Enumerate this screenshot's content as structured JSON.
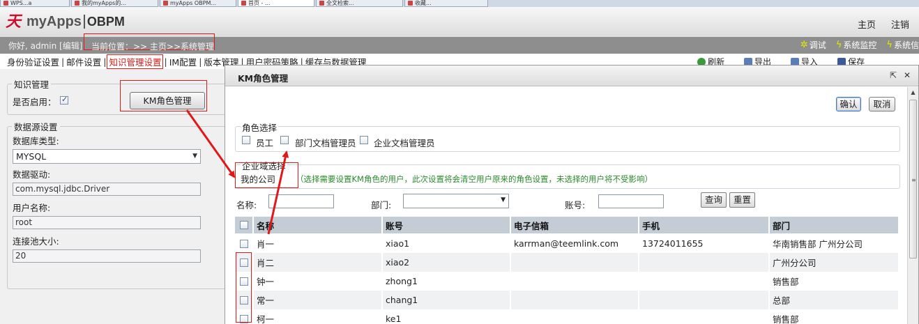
{
  "browser_tabs": [
    "WPS...a",
    "我的myApps的...",
    "myApps OBPM...",
    "首页 - ...",
    "全文检索...",
    "收藏..."
  ],
  "app": {
    "brand": "myApps",
    "product": "OBPM",
    "top_links": [
      "主页",
      "注销"
    ]
  },
  "infobar": {
    "greeting": "你好, admin [编辑]",
    "location": "当前位置：>> 主页>>系统管理",
    "tools": [
      {
        "icon": "debug-icon",
        "label": "调试"
      },
      {
        "icon": "lightning-icon",
        "label": "系统监控"
      },
      {
        "icon": "lightning-icon",
        "label": "系统信"
      }
    ]
  },
  "settings_tabs": [
    "身份验证设置",
    "邮件设置",
    "知识管理设置",
    "IM配置",
    "版本管理",
    "用户密码策略",
    "缓存与数据管理"
  ],
  "settings_tab_active": 2,
  "right_toolbar": [
    "刷新",
    "导出",
    "导入",
    "保存"
  ],
  "left": {
    "km_legend": "知识管理",
    "enable_label": "是否启用：",
    "km_role_button": "KM角色管理",
    "ds_legend": "数据源设置",
    "db_type_label": "数据库类型:",
    "db_type_value": "MYSQL",
    "driver_label": "数据驱动:",
    "driver_value": "com.mysql.jdbc.Driver",
    "user_label": "用户名称:",
    "user_value": "root",
    "pool_label": "连接池大小:",
    "pool_value": "20"
  },
  "modal": {
    "title": "KM角色管理",
    "ok": "确认",
    "cancel": "取消",
    "role_legend": "角色选择",
    "roles": [
      "员工",
      "部门文档管理员",
      "企业文档管理员"
    ],
    "corp_legend": "企业域选择",
    "corp_value": "我的公司",
    "hint": "（选择需要设置KM角色的用户，此次设置将会清空用户原来的角色设置，未选择的用户将不受影响）",
    "filter": {
      "name_label": "名称:",
      "dept_label": "部门:",
      "account_label": "账号:",
      "search": "查询",
      "reset": "重置"
    },
    "columns": [
      "名称",
      "账号",
      "电子信箱",
      "手机",
      "部门"
    ],
    "rows": [
      {
        "name": "肖一",
        "account": "xiao1",
        "email": "karrman@teemlink.com",
        "phone": "13724011655",
        "dept": "华南销售部  广州分公司"
      },
      {
        "name": "肖二",
        "account": "xiao2",
        "email": "",
        "phone": "",
        "dept": "广州分公司"
      },
      {
        "name": "钟一",
        "account": "zhong1",
        "email": "",
        "phone": "",
        "dept": "销售部"
      },
      {
        "name": "常一",
        "account": "chang1",
        "email": "",
        "phone": "",
        "dept": "总部"
      },
      {
        "name": "柯一",
        "account": "ke1",
        "email": "",
        "phone": "",
        "dept": "销售部"
      }
    ]
  },
  "colors": {
    "annotation_red": "#e01818",
    "header_gray": "#8e8e8e",
    "grid_header": "#c4cdd6",
    "hint_green": "#2b8a2b"
  }
}
